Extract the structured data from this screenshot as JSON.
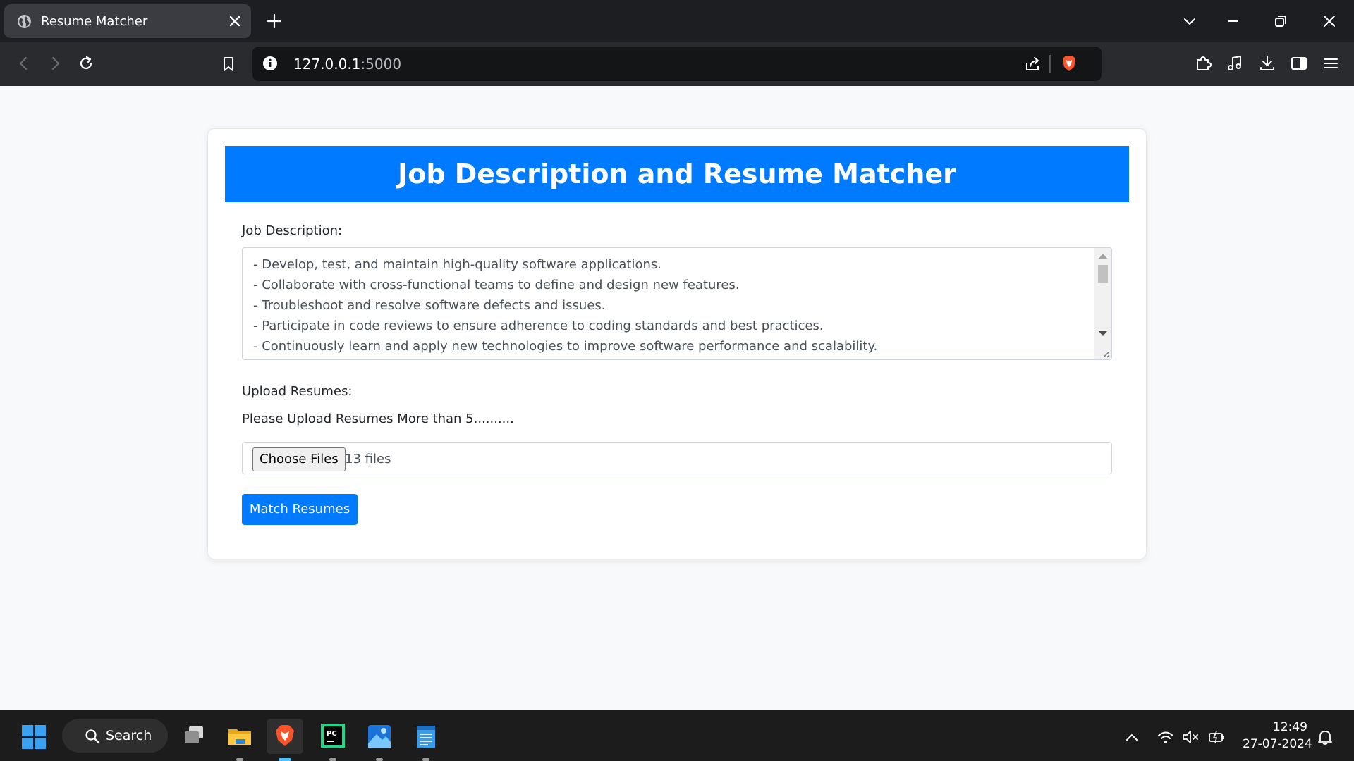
{
  "browser": {
    "tab": {
      "title": "Resume Matcher",
      "icon": "globe-icon"
    },
    "url": {
      "host": "127.0.0.1",
      "port": ":5000"
    }
  },
  "page": {
    "title": "Job Description and Resume Matcher",
    "job_description_label": "Job Description:",
    "job_description_lines": [
      "- Develop, test, and maintain high-quality software applications.",
      "- Collaborate with cross-functional teams to define and design new features.",
      "- Troubleshoot and resolve software defects and issues.",
      "- Participate in code reviews to ensure adherence to coding standards and best practices.",
      "- Continuously learn and apply new technologies to improve software performance and scalability."
    ],
    "upload_label": "Upload Resumes:",
    "upload_hint": "Please Upload Resumes More than 5..........",
    "choose_files_label": "Choose Files",
    "file_count": "13 files",
    "submit_label": "Match Resumes"
  },
  "taskbar": {
    "search_label": "Search",
    "time": "12:49",
    "date": "27-07-2024"
  },
  "colors": {
    "primary": "#007bff",
    "page_bg": "#f8f9fa",
    "brave_orange": "#fb542b",
    "taskbar_active": "#4cc2ff"
  }
}
